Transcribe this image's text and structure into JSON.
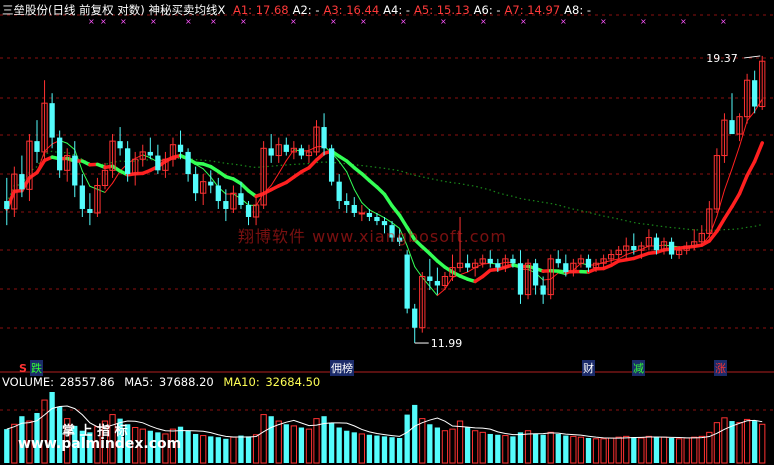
{
  "header": {
    "title": "三垒股份(日线 前复权 对数) 神秘买卖均线X",
    "items": [
      {
        "label": "A1:",
        "value": "17.68",
        "color": "#ff3a3a"
      },
      {
        "label": "A2:",
        "value": "-",
        "color": "#ffffff"
      },
      {
        "label": "A3:",
        "value": "16.44",
        "color": "#ff3a3a"
      },
      {
        "label": "A4:",
        "value": "-",
        "color": "#ffffff"
      },
      {
        "label": "A5:",
        "value": "15.13",
        "color": "#ff3a3a"
      },
      {
        "label": "A6:",
        "value": "-",
        "color": "#ffffff"
      },
      {
        "label": "A7:",
        "value": "14.97",
        "color": "#ff3a3a"
      },
      {
        "label": "A8:",
        "value": "-",
        "color": "#ffffff"
      }
    ]
  },
  "volume_header": {
    "label": "VOLUME:",
    "value": "28557.86",
    "ma5_label": "MA5:",
    "ma5_value": "37688.20",
    "ma10_label": "MA10:",
    "ma10_value": "32684.50"
  },
  "tags": [
    {
      "text": "跌",
      "color": "#33ff33"
    },
    {
      "text": "佣榜",
      "color": "#ffffff"
    },
    {
      "text": "财",
      "color": "#ffffff"
    },
    {
      "text": "减",
      "color": "#33ff33"
    },
    {
      "text": "涨",
      "color": "#ff3333"
    }
  ],
  "marker_s": "S",
  "watermark": "翔博软件 www.xiangbosoft.com",
  "watermark2": "掌 上 指 标",
  "watermark3": "www.palmindex.com",
  "chart_data": {
    "type": "candlestick",
    "scale": "log",
    "price_range": [
      11.5,
      20.5
    ],
    "max_label": "19.37",
    "min_label": "11.99",
    "colors": {
      "up": "#ff3232",
      "down": "#54fcfc",
      "ma_up": "#ff2020",
      "ma_down": "#33ff55",
      "dotted": "#1a8a1a",
      "grid": "#8a1010"
    },
    "candles": [
      [
        15.2,
        15.8,
        14.6,
        15.0
      ],
      [
        15.0,
        16.1,
        14.8,
        15.9
      ],
      [
        15.9,
        16.4,
        15.3,
        15.5
      ],
      [
        15.5,
        17.0,
        15.2,
        16.8
      ],
      [
        16.8,
        17.4,
        16.2,
        16.5
      ],
      [
        16.5,
        18.6,
        16.3,
        17.9
      ],
      [
        17.9,
        18.2,
        16.6,
        16.9
      ],
      [
        16.9,
        17.1,
        15.8,
        16.0
      ],
      [
        16.0,
        16.6,
        15.7,
        16.4
      ],
      [
        16.4,
        16.8,
        15.3,
        15.6
      ],
      [
        15.6,
        15.9,
        14.8,
        15.0
      ],
      [
        15.0,
        15.4,
        14.6,
        14.9
      ],
      [
        14.9,
        15.8,
        14.8,
        15.6
      ],
      [
        15.6,
        16.2,
        15.5,
        16.0
      ],
      [
        16.0,
        17.0,
        15.8,
        16.8
      ],
      [
        16.8,
        17.2,
        16.4,
        16.6
      ],
      [
        16.6,
        16.8,
        15.7,
        15.9
      ],
      [
        15.9,
        16.5,
        15.6,
        16.3
      ],
      [
        16.3,
        16.7,
        16.1,
        16.5
      ],
      [
        16.5,
        16.9,
        16.3,
        16.4
      ],
      [
        16.4,
        16.7,
        15.9,
        16.0
      ],
      [
        16.0,
        16.5,
        15.8,
        16.3
      ],
      [
        16.3,
        16.9,
        16.1,
        16.7
      ],
      [
        16.7,
        17.1,
        16.3,
        16.5
      ],
      [
        16.5,
        16.6,
        15.7,
        15.9
      ],
      [
        15.9,
        16.1,
        15.2,
        15.4
      ],
      [
        15.4,
        15.9,
        15.1,
        15.7
      ],
      [
        15.7,
        16.0,
        15.4,
        15.6
      ],
      [
        15.6,
        15.8,
        15.0,
        15.2
      ],
      [
        15.2,
        15.5,
        14.7,
        15.0
      ],
      [
        15.0,
        15.6,
        14.9,
        15.4
      ],
      [
        15.4,
        15.7,
        15.0,
        15.1
      ],
      [
        15.1,
        15.2,
        14.6,
        14.8
      ],
      [
        14.8,
        15.3,
        14.6,
        15.1
      ],
      [
        15.1,
        16.8,
        15.0,
        16.6
      ],
      [
        16.6,
        17.0,
        16.2,
        16.4
      ],
      [
        16.4,
        16.9,
        16.2,
        16.7
      ],
      [
        16.7,
        16.9,
        16.4,
        16.5
      ],
      [
        16.5,
        16.8,
        16.3,
        16.6
      ],
      [
        16.6,
        16.7,
        16.3,
        16.4
      ],
      [
        16.4,
        16.7,
        16.2,
        16.5
      ],
      [
        16.5,
        17.4,
        16.4,
        17.2
      ],
      [
        17.2,
        17.6,
        16.4,
        16.6
      ],
      [
        16.6,
        16.7,
        15.6,
        15.7
      ],
      [
        15.7,
        15.9,
        15.0,
        15.2
      ],
      [
        15.2,
        15.4,
        14.9,
        15.1
      ],
      [
        15.1,
        15.3,
        14.8,
        14.9
      ],
      [
        14.9,
        15.1,
        14.7,
        14.9
      ],
      [
        14.9,
        15.0,
        14.7,
        14.8
      ],
      [
        14.8,
        14.9,
        14.6,
        14.7
      ],
      [
        14.7,
        14.8,
        14.4,
        14.6
      ],
      [
        14.6,
        14.7,
        14.2,
        14.3
      ],
      [
        14.3,
        14.5,
        14.1,
        14.2
      ],
      [
        13.9,
        14.0,
        12.6,
        12.7
      ],
      [
        12.7,
        12.8,
        11.99,
        12.3
      ],
      [
        12.3,
        13.5,
        12.2,
        13.4
      ],
      [
        13.4,
        13.8,
        13.1,
        13.3
      ],
      [
        13.3,
        13.6,
        13.0,
        13.2
      ],
      [
        13.2,
        13.5,
        13.1,
        13.4
      ],
      [
        13.4,
        13.9,
        13.3,
        13.6
      ],
      [
        13.6,
        14.8,
        13.5,
        13.7
      ],
      [
        13.7,
        13.9,
        13.5,
        13.6
      ],
      [
        13.6,
        13.8,
        13.4,
        13.7
      ],
      [
        13.7,
        13.9,
        13.6,
        13.8
      ],
      [
        13.8,
        14.0,
        13.6,
        13.7
      ],
      [
        13.7,
        13.8,
        13.5,
        13.6
      ],
      [
        13.6,
        13.9,
        13.5,
        13.8
      ],
      [
        13.8,
        13.9,
        13.6,
        13.7
      ],
      [
        13.7,
        14.0,
        12.8,
        13.0
      ],
      [
        13.0,
        13.8,
        12.9,
        13.7
      ],
      [
        13.7,
        13.8,
        13.0,
        13.2
      ],
      [
        13.2,
        13.4,
        12.8,
        13.0
      ],
      [
        13.0,
        13.9,
        12.9,
        13.8
      ],
      [
        13.8,
        14.0,
        13.6,
        13.7
      ],
      [
        13.7,
        13.9,
        13.4,
        13.5
      ],
      [
        13.5,
        13.8,
        13.4,
        13.7
      ],
      [
        13.7,
        13.9,
        13.6,
        13.8
      ],
      [
        13.8,
        13.9,
        13.5,
        13.6
      ],
      [
        13.6,
        13.8,
        13.5,
        13.7
      ],
      [
        13.7,
        13.9,
        13.6,
        13.8
      ],
      [
        13.8,
        14.0,
        13.7,
        13.9
      ],
      [
        13.9,
        14.1,
        13.8,
        14.0
      ],
      [
        14.0,
        14.3,
        13.8,
        14.1
      ],
      [
        14.1,
        14.4,
        13.9,
        14.0
      ],
      [
        14.0,
        14.2,
        13.8,
        14.1
      ],
      [
        14.1,
        14.5,
        14.0,
        14.3
      ],
      [
        14.3,
        14.4,
        13.9,
        14.0
      ],
      [
        14.0,
        14.3,
        13.9,
        14.2
      ],
      [
        14.2,
        14.3,
        13.8,
        13.9
      ],
      [
        13.9,
        14.1,
        13.8,
        14.0
      ],
      [
        14.0,
        14.2,
        13.9,
        14.1
      ],
      [
        14.1,
        14.5,
        14.0,
        14.2
      ],
      [
        14.2,
        14.6,
        14.1,
        14.4
      ],
      [
        14.4,
        15.2,
        14.3,
        15.0
      ],
      [
        15.0,
        16.6,
        14.9,
        16.4
      ],
      [
        16.4,
        17.6,
        16.2,
        17.4
      ],
      [
        17.4,
        18.2,
        17.0,
        17.0
      ],
      [
        17.0,
        17.6,
        16.8,
        17.5
      ],
      [
        17.5,
        18.8,
        17.3,
        18.6
      ],
      [
        18.6,
        18.9,
        17.6,
        17.8
      ],
      [
        17.8,
        19.37,
        17.7,
        19.2
      ]
    ],
    "volume": [
      42,
      48,
      58,
      52,
      62,
      78,
      88,
      70,
      55,
      46,
      40,
      38,
      45,
      52,
      60,
      55,
      48,
      44,
      42,
      40,
      38,
      36,
      42,
      45,
      40,
      36,
      34,
      33,
      32,
      30,
      32,
      34,
      33,
      35,
      60,
      58,
      52,
      48,
      46,
      44,
      42,
      55,
      58,
      50,
      44,
      40,
      38,
      36,
      35,
      34,
      33,
      32,
      31,
      60,
      72,
      55,
      48,
      44,
      40,
      42,
      52,
      44,
      40,
      38,
      36,
      35,
      34,
      33,
      38,
      40,
      36,
      35,
      38,
      36,
      34,
      33,
      32,
      31,
      30,
      30,
      31,
      32,
      33,
      32,
      31,
      33,
      32,
      32,
      31,
      30,
      31,
      32,
      33,
      38,
      50,
      56,
      52,
      50,
      54,
      52,
      48
    ]
  }
}
